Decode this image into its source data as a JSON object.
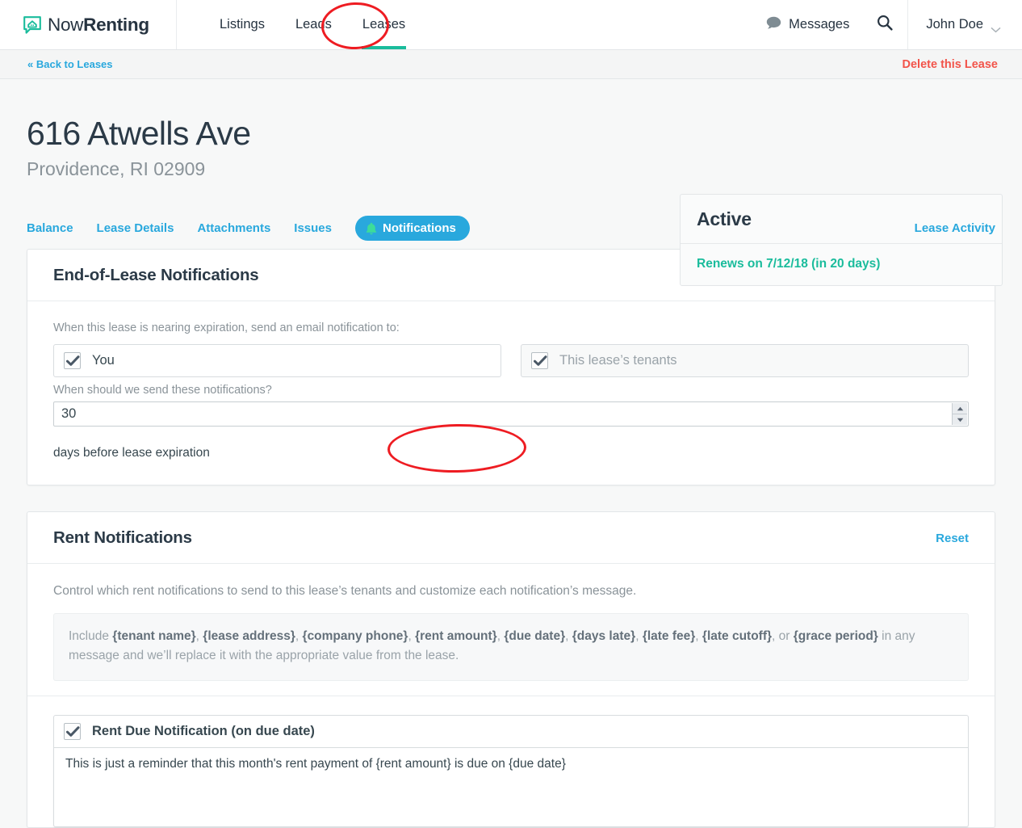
{
  "brand": {
    "name_light": "Now",
    "name_bold": "Renting",
    "icon": "speech-bubble-house-icon"
  },
  "topnav": {
    "items": [
      {
        "label": "Listings",
        "active": false
      },
      {
        "label": "Leads",
        "active": false
      },
      {
        "label": "Leases",
        "active": true
      }
    ],
    "messages_label": "Messages",
    "messages_icon": "chat-bubble-icon",
    "search_icon": "search-icon",
    "user_name": "John Doe",
    "user_caret_icon": "chevron-down-icon"
  },
  "subbar": {
    "back_label": "« Back to Leases",
    "delete_label": "Delete this Lease"
  },
  "lease": {
    "address_line1": "616 Atwells Ave",
    "address_line2": "Providence, RI 02909"
  },
  "status_card": {
    "status": "Active",
    "renewal": "Renews on 7/12/18 (in 20 days)"
  },
  "tabs": {
    "items": [
      {
        "label": "Balance",
        "active": false
      },
      {
        "label": "Lease Details",
        "active": false
      },
      {
        "label": "Attachments",
        "active": false
      },
      {
        "label": "Issues",
        "active": false
      }
    ],
    "active_tab": {
      "label": "Notifications",
      "icon": "bell-icon"
    },
    "lease_activity_label": "Lease Activity"
  },
  "end_of_lease": {
    "heading": "End-of-Lease Notifications",
    "prompt": "When this lease is nearing expiration, send an email notification to:",
    "recipient_you": {
      "label": "You",
      "checked": true
    },
    "recipient_tenants": {
      "label": "This lease’s tenants",
      "checked": true
    },
    "timing_label": "When should we send these notifications?",
    "timing_value": "30",
    "timing_suffix": "days before lease expiration",
    "spinner_up_icon": "spinner-up-icon",
    "spinner_down_icon": "spinner-down-icon"
  },
  "rent_notifications": {
    "heading": "Rent Notifications",
    "reset_label": "Reset",
    "description": "Control which rent notifications to send to this lease’s tenants and customize each notification’s message.",
    "tokens_intro": "Include ",
    "tokens": [
      "{tenant name}",
      "{lease address}",
      "{company phone}",
      "{rent amount}",
      "{due date}",
      "{days late}",
      "{late fee}",
      "{late cutoff}",
      "{grace period}"
    ],
    "tokens_or": ", or ",
    "tokens_outro": " in any message and we’ll replace it with the appropriate value from the lease.",
    "rent_due": {
      "label": "Rent Due Notification (on due date)",
      "checked": true,
      "message": "This is just a reminder that this month's rent payment of {rent amount} is due on {due date}"
    }
  },
  "annotations": {
    "color": "#ee1c22",
    "ellipses": [
      "leases-nav-highlight",
      "notifications-tab-highlight"
    ]
  }
}
